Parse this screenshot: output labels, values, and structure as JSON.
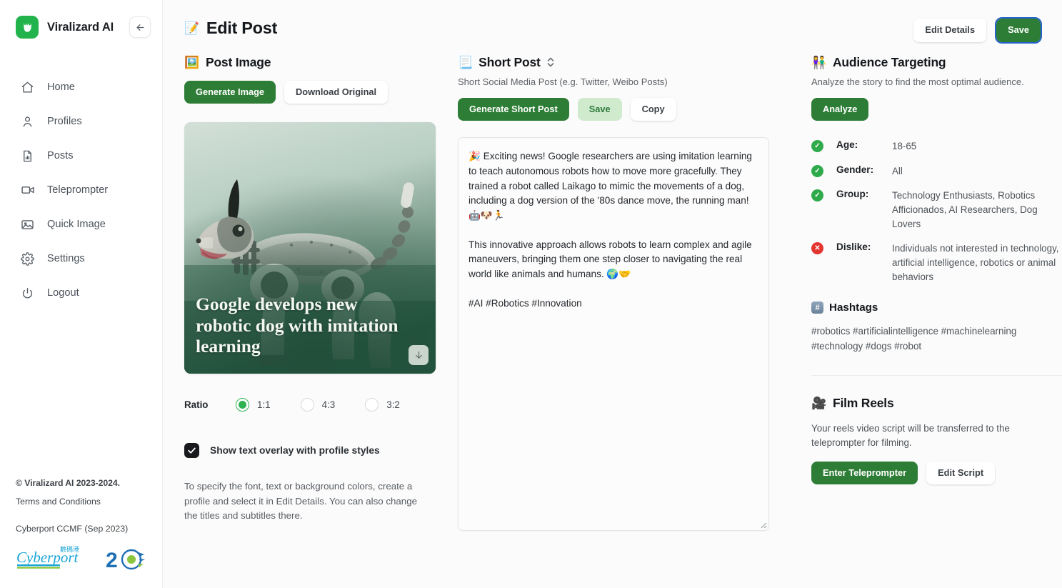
{
  "sidebar": {
    "brand_name": "Viralizard AI",
    "collapse_icon": "arrow-left-icon",
    "items": [
      {
        "label": "Home",
        "icon": "home-icon"
      },
      {
        "label": "Profiles",
        "icon": "user-icon"
      },
      {
        "label": "Posts",
        "icon": "document-chart-icon"
      },
      {
        "label": "Teleprompter",
        "icon": "video-camera-icon"
      },
      {
        "label": "Quick Image",
        "icon": "image-icon"
      },
      {
        "label": "Settings",
        "icon": "gear-icon"
      },
      {
        "label": "Logout",
        "icon": "power-icon"
      }
    ],
    "footer": {
      "copyright": "© Viralizard AI 2023-2024.",
      "terms": "Terms and Conditions",
      "ccmf": "Cyberport CCMF (Sep 2023)",
      "logo_alt": "Cyberport 20"
    }
  },
  "header": {
    "title": "Edit Post",
    "title_emoji": "📝",
    "edit_details_label": "Edit Details",
    "save_label": "Save"
  },
  "post_image": {
    "section_title": "Post Image",
    "section_emoji": "🖼️",
    "generate_label": "Generate Image",
    "download_label": "Download Original",
    "overlay_title": "Google develops new robotic dog with imitation learning",
    "download_icon": "download-arrow-icon",
    "ratio_label": "Ratio",
    "ratio_options": [
      {
        "value": "1:1",
        "selected": true
      },
      {
        "value": "4:3",
        "selected": false
      },
      {
        "value": "3:2",
        "selected": false
      }
    ],
    "overlay_checkbox_label": "Show text overlay with profile styles",
    "overlay_checkbox_checked": true,
    "help_text": "To specify the font, text or background colors, create a profile and select it in Edit Details. You can also change the titles and subtitles there."
  },
  "short_post": {
    "section_title": "Short Post",
    "section_emoji": "📃",
    "sort_icon": "chevron-updown-icon",
    "subtitle": "Short Social Media Post (e.g. Twitter, Weibo Posts)",
    "generate_label": "Generate Short Post",
    "save_label": "Save",
    "copy_label": "Copy",
    "content_paragraphs": [
      "🎉 Exciting news! Google researchers are using imitation learning to teach autonomous robots how to move more gracefully. They trained a robot called Laikago to mimic the movements of a dog, including a dog version of the '80s dance move, the running man! 🤖🐶🏃",
      "This innovative approach allows robots to learn complex and agile maneuvers, bringing them one step closer to navigating the real world like animals and humans. 🌍🤝",
      "#AI #Robotics #Innovation"
    ]
  },
  "audience": {
    "section_title": "Audience Targeting",
    "section_emoji": "👫",
    "description": "Analyze the story to find the most optimal audience.",
    "analyze_label": "Analyze",
    "rows": [
      {
        "status": "ok",
        "key": "Age:",
        "value": "18-65"
      },
      {
        "status": "ok",
        "key": "Gender:",
        "value": "All"
      },
      {
        "status": "ok",
        "key": "Group:",
        "value": "Technology Enthusiasts, Robotics Afficionados, AI Researchers, Dog Lovers"
      },
      {
        "status": "no",
        "key": "Dislike:",
        "value": "Individuals not interested in technology, artificial intelligence, robotics or animal behaviors"
      }
    ]
  },
  "hashtags": {
    "section_title": "Hashtags",
    "section_emoji": "#️⃣",
    "value": "#robotics #artificialintelligence #machinelearning #technology #dogs #robot"
  },
  "film_reels": {
    "section_title": "Film Reels",
    "section_emoji": "🎥",
    "description": "Your reels video script will be transferred to the teleprompter for filming.",
    "enter_teleprompter_label": "Enter Teleprompter",
    "edit_script_label": "Edit Script"
  },
  "colors": {
    "brand_green": "#22b34c",
    "button_green": "#2e7d36",
    "radio_green": "#2eb350",
    "status_ok": "#2faa4b",
    "status_no": "#e3342f",
    "focus_ring": "#2563c9"
  }
}
